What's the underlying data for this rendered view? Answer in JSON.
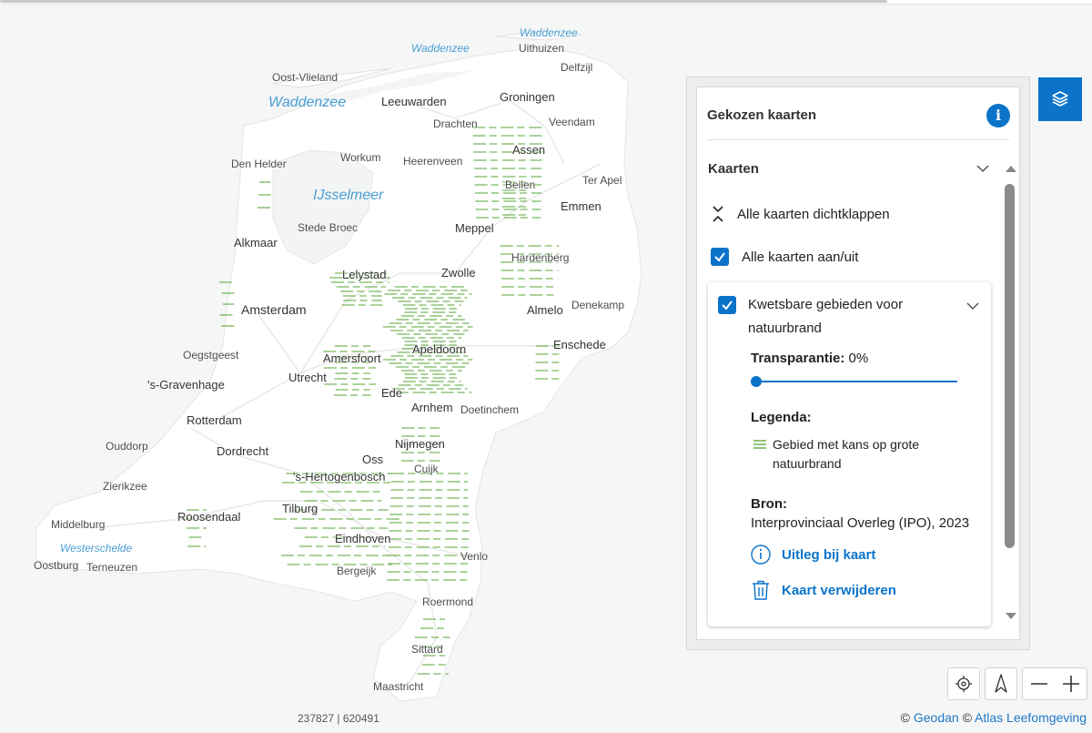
{
  "map": {
    "cities": [
      {
        "name": "Oost-Vlieland"
      },
      {
        "name": "Leeuwarden"
      },
      {
        "name": "Groningen"
      },
      {
        "name": "Uithuizen"
      },
      {
        "name": "Delfzijl"
      },
      {
        "name": "Drachten"
      },
      {
        "name": "Veendam"
      },
      {
        "name": "Assen"
      },
      {
        "name": "Den Helder"
      },
      {
        "name": "Workum"
      },
      {
        "name": "Heerenveen"
      },
      {
        "name": "Ter Apel"
      },
      {
        "name": "Beilen"
      },
      {
        "name": "Emmen"
      },
      {
        "name": "Stede Broec"
      },
      {
        "name": "Meppel"
      },
      {
        "name": "Alkmaar"
      },
      {
        "name": "Hardenberg"
      },
      {
        "name": "Lelystad"
      },
      {
        "name": "Zwolle"
      },
      {
        "name": "Amsterdam"
      },
      {
        "name": "Almelo"
      },
      {
        "name": "Denekamp"
      },
      {
        "name": "Enschede"
      },
      {
        "name": "Apeldoorn"
      },
      {
        "name": "Oegstgeest"
      },
      {
        "name": "Amersfoort"
      },
      {
        "name": "'s-Gravenhage"
      },
      {
        "name": "Utrecht"
      },
      {
        "name": "Ede"
      },
      {
        "name": "Arnhem"
      },
      {
        "name": "Doetinchem"
      },
      {
        "name": "Rotterdam"
      },
      {
        "name": "Ouddorp"
      },
      {
        "name": "Dordrecht"
      },
      {
        "name": "Nijmegen"
      },
      {
        "name": "Oss"
      },
      {
        "name": "Zierikzee"
      },
      {
        "name": "'s-Hertogenbosch"
      },
      {
        "name": "Cuijk"
      },
      {
        "name": "Tilburg"
      },
      {
        "name": "Roosendaal"
      },
      {
        "name": "Middelburg"
      },
      {
        "name": "Eindhoven"
      },
      {
        "name": "Oostburg"
      },
      {
        "name": "Terneuzen"
      },
      {
        "name": "Venlo"
      },
      {
        "name": "Bergeijk"
      },
      {
        "name": "Roermond"
      },
      {
        "name": "Sittard"
      },
      {
        "name": "Maastricht"
      }
    ],
    "water": [
      {
        "name": "Waddenzee"
      },
      {
        "name": "Waddenzee"
      },
      {
        "name": "Waddenzee"
      },
      {
        "name": "IJsselmeer"
      },
      {
        "name": "Westerschelde"
      }
    ],
    "coords": "237827 | 620491",
    "attribution": {
      "c1": "©",
      "geodan": "Geodan",
      "c2": "©",
      "atlas": "Atlas Leefomgeving"
    }
  },
  "panel": {
    "title": "Gekozen kaarten",
    "info_icon": "info-icon",
    "section": "Kaarten",
    "collapse_all": "Alle kaarten dichtklappen",
    "toggle_all": "Alle kaarten aan/uit",
    "layer": {
      "title": "Kwetsbare gebieden voor natuurbrand",
      "transparency_label": "Transparantie:",
      "transparency_value": "0%",
      "transparency_fraction": 0,
      "legend_label": "Legenda:",
      "legend_item": "Gebied met kans op grote natuurbrand",
      "legend_color": "#6ab04c",
      "source_label": "Bron:",
      "source_value": "Interprovinciaal Overleg (IPO), 2023",
      "explain_link": "Uitleg bij kaart",
      "remove_link": "Kaart verwijderen"
    }
  },
  "colors": {
    "accent": "#0b73c9",
    "land": "#ffffff",
    "sea": "#f5f6f6",
    "water_label": "#4a9fd4",
    "fire_zone": "#6ab04c"
  }
}
